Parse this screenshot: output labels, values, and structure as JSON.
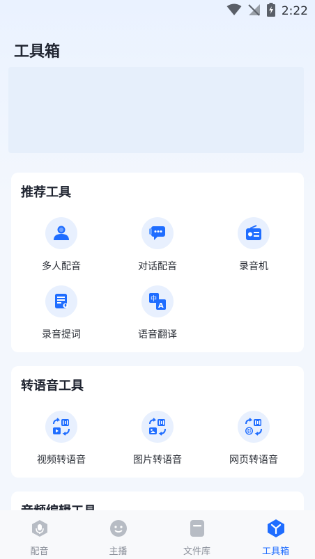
{
  "status_bar": {
    "time": "2:22"
  },
  "header": {
    "title": "工具箱"
  },
  "sections": [
    {
      "title": "推荐工具",
      "tools": [
        {
          "label": "多人配音",
          "icon": "people-icon"
        },
        {
          "label": "对话配音",
          "icon": "chat-icon"
        },
        {
          "label": "录音机",
          "icon": "recorder-icon"
        },
        {
          "label": "录音提词",
          "icon": "teleprompter-icon"
        },
        {
          "label": "语音翻译",
          "icon": "translate-icon"
        }
      ]
    },
    {
      "title": "转语音工具",
      "tools": [
        {
          "label": "视频转语音",
          "icon": "video-to-audio-icon"
        },
        {
          "label": "图片转语音",
          "icon": "image-to-audio-icon"
        },
        {
          "label": "网页转语音",
          "icon": "web-to-audio-icon"
        }
      ]
    },
    {
      "title": "音频编辑工具"
    }
  ],
  "tabbar": [
    {
      "label": "配音",
      "icon": "dubbing-icon",
      "active": false
    },
    {
      "label": "主播",
      "icon": "anchor-icon",
      "active": false
    },
    {
      "label": "文件库",
      "icon": "file-library-icon",
      "active": false
    },
    {
      "label": "工具箱",
      "icon": "toolbox-icon",
      "active": true
    }
  ],
  "colors": {
    "accent": "#1f6dff",
    "icon_bg": "#e8f0fe",
    "inactive": "#a3a8b1"
  }
}
